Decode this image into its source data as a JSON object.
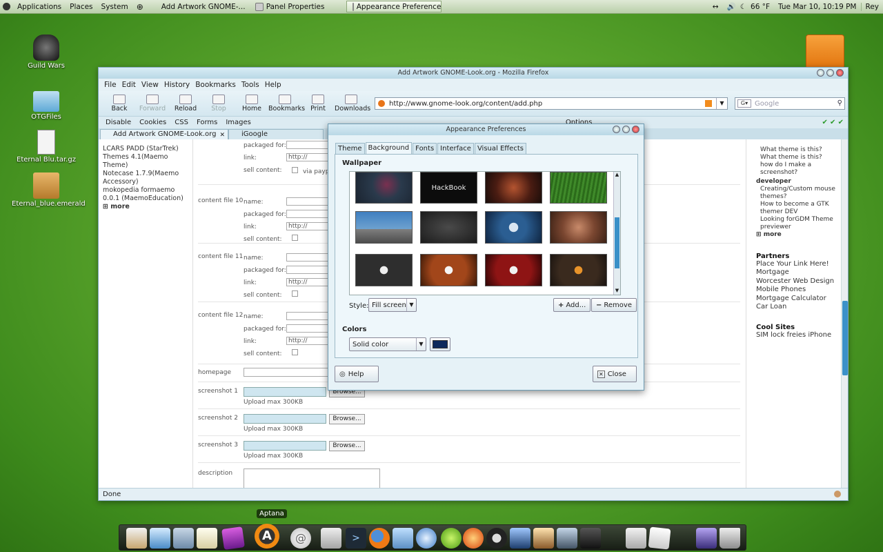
{
  "top_panel": {
    "menus": [
      "Applications",
      "Places",
      "System"
    ],
    "tasks": [
      {
        "label": "Add Artwork GNOME-..."
      },
      {
        "label": "Panel Properties"
      },
      {
        "label": "Appearance Preferences"
      }
    ],
    "temperature": "66 °F",
    "clock": "Tue Mar 10, 10:19 PM",
    "user": "Rey"
  },
  "desktop_icons": [
    {
      "label": "Guild Wars",
      "icon": "helmet-icon"
    },
    {
      "label": "OTGFiles",
      "icon": "folder-icon"
    },
    {
      "label": "Eternal Blu.tar.gz",
      "icon": "archive-icon"
    },
    {
      "label": "Eternal_blue.emerald",
      "icon": "package-icon"
    }
  ],
  "firefox": {
    "title": "Add Artwork GNOME-Look.org - Mozilla Firefox",
    "menus": [
      "File",
      "Edit",
      "View",
      "History",
      "Bookmarks",
      "Tools",
      "Help"
    ],
    "nav": {
      "back": "Back",
      "forward": "Forward",
      "reload": "Reload",
      "stop": "Stop",
      "home": "Home",
      "bookmarks": "Bookmarks",
      "print": "Print",
      "downloads": "Downloads"
    },
    "url": "http://www.gnome-look.org/content/add.php",
    "search_placeholder": "Google",
    "devbar": [
      "Disable",
      "Cookies",
      "CSS",
      "Forms",
      "Images",
      "Options"
    ],
    "tabs": [
      {
        "label": "Add Artwork GNOME-Look.org"
      },
      {
        "label": "iGoogle"
      }
    ],
    "left_col": {
      "items": [
        "LCARS PADD (StarTrek) Themes 4.1(Maemo Theme)",
        "Notecase 1.7.9(Maemo Accessory)",
        "mokopedia formaemo 0.0.1 (MaemoEducation)"
      ],
      "more": "more"
    },
    "form": {
      "packaged_for": "packaged for:",
      "link": "link:",
      "link_value": "http://",
      "sell": "sell content:",
      "via": "via paypal",
      "name": "name:",
      "sections": [
        "content file 10",
        "content file 11",
        "content file 12"
      ],
      "homepage": "homepage",
      "screenshots": [
        "screenshot 1",
        "screenshot 2",
        "screenshot 3"
      ],
      "browse": "Browse...",
      "upload_hint": "Upload max 300KB",
      "description": "description"
    },
    "right_col": {
      "questions": [
        "What theme is this?",
        "What theme is this?",
        "how do I make a screenshot?"
      ],
      "developer": "developer",
      "dev_items": [
        "Creating/Custom mouse themes?",
        "How to become a GTK themer DEV",
        "Looking forGDM Theme previewer"
      ],
      "more": "more",
      "partners_title": "Partners",
      "partners": [
        "Place Your Link Here!",
        "Mortgage",
        "Worcester Web Design",
        "Mobile Phones",
        "Mortgage Calculator",
        "Car Loan"
      ],
      "cool_title": "Cool Sites",
      "cool": [
        "SIM lock freies iPhone"
      ]
    },
    "status": "Done"
  },
  "dialog": {
    "title": "Appearance Preferences",
    "tabs": [
      "Theme",
      "Background",
      "Fonts",
      "Interface",
      "Visual Effects"
    ],
    "wallpaper_label": "Wallpaper",
    "hackbook_text": "HackBook",
    "style_label": "Style:",
    "style_value": "Fill screen",
    "add": "Add...",
    "remove": "Remove",
    "colors_label": "Colors",
    "color_mode": "Solid color",
    "color_swatch": "#0d2a5c",
    "help": "Help",
    "close": "Close"
  },
  "dock": {
    "tooltip": "Aptana"
  }
}
